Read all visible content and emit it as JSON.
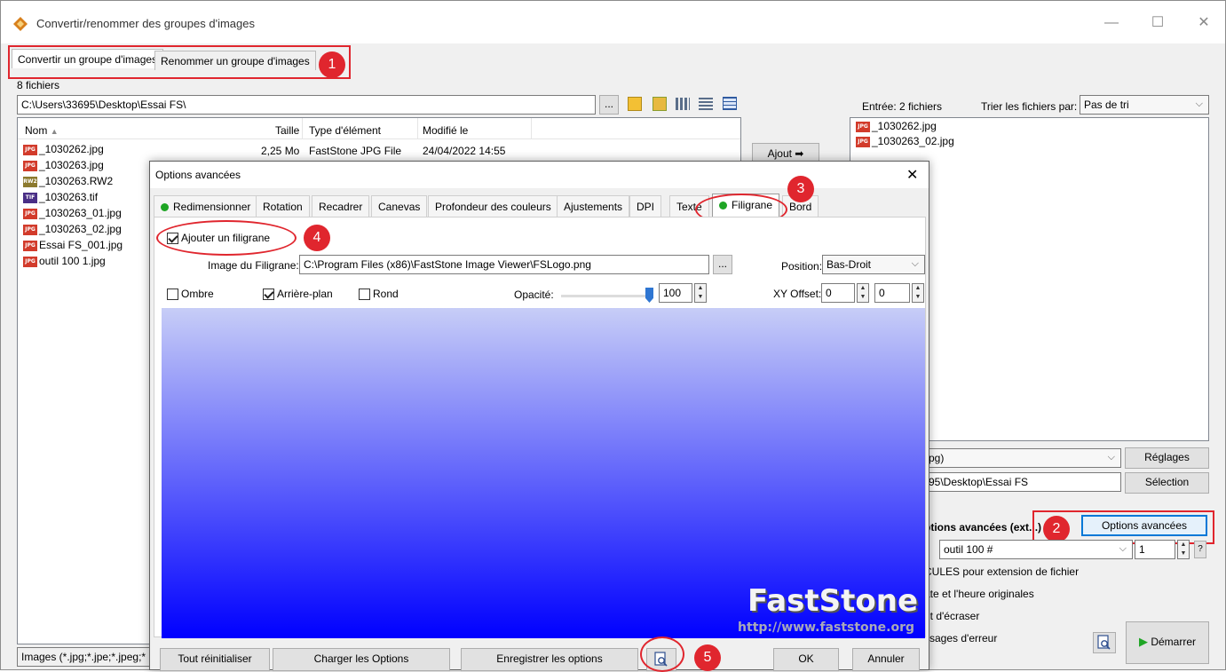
{
  "window": {
    "title": "Convertir/renommer des groupes d'images",
    "minimize": "—",
    "maximize": "☐",
    "close": "✕"
  },
  "main_tabs": [
    "Convertir un groupe d'images",
    "Renommer un groupe d'images"
  ],
  "file_count": "8 fichiers",
  "path": "C:\\Users\\33695\\Desktop\\Essai FS\\",
  "browse": "...",
  "columns": {
    "name": "Nom",
    "size": "Taille",
    "type": "Type d'élément",
    "modified": "Modifié le"
  },
  "files": [
    {
      "icon": "JPG",
      "name": "_1030262.jpg",
      "size": "2,25 Mo",
      "type": "FastStone JPG File",
      "modified": "24/04/2022 14:55"
    },
    {
      "icon": "JPG",
      "name": "_1030263.jpg"
    },
    {
      "icon": "RW2",
      "name": "_1030263.RW2"
    },
    {
      "icon": "TIF",
      "name": "_1030263.tif"
    },
    {
      "icon": "JPG",
      "name": "_1030263_01.jpg"
    },
    {
      "icon": "JPG",
      "name": "_1030263_02.jpg"
    },
    {
      "icon": "JPG",
      "name": "Essai FS_001.jpg"
    },
    {
      "icon": "JPG",
      "name": "outil 100 1.jpg"
    }
  ],
  "filter": "Images (*.jpg;*.jpe;*.jpeg;*",
  "add_button": "Ajout ➡",
  "input_label": "Entrée:  2 fichiers",
  "sort_label": "Trier les fichiers par:",
  "sort_value": "Pas de tri",
  "input_files": [
    "_1030262.jpg",
    "_1030263_02.jpg"
  ],
  "right_panel": {
    "format_value": "pg)",
    "reglages": "Réglages",
    "out_path": "95\\Desktop\\Essai FS",
    "selection": "Sélection",
    "adv_label": "ptions avancées (ext...)",
    "adv_button": "Options avancées",
    "rename_value": "outil 100 #",
    "rename_num": "1",
    "help": "?",
    "opt1": "CULES pour extension de fichier",
    "opt2": "ate et l'heure originales",
    "opt3": "nt d'écraser",
    "opt4": "ssages d'erreur",
    "start": "Démarrer"
  },
  "dialog": {
    "title": "Options avancées",
    "close": "✕",
    "tabs": [
      "Redimensionner",
      "Rotation",
      "Recadrer",
      "Canevas",
      "Profondeur des couleurs",
      "Ajustements",
      "DPI",
      "Texte",
      "Filigrane",
      "Bord"
    ],
    "add_watermark": "Ajouter un filigrane",
    "image_label": "Image du Filigrane:",
    "image_path": "C:\\Program Files (x86)\\FastStone Image Viewer\\FSLogo.png",
    "browse": "...",
    "position_label": "Position:",
    "position_value": "Bas-Droit",
    "shadow": "Ombre",
    "background": "Arrière-plan",
    "round": "Rond",
    "opacity_label": "Opacité:",
    "opacity_value": "100",
    "opacity_level": 1.0,
    "xy_label": "XY Offset:",
    "x_offset": "0",
    "y_offset": "0",
    "logo_main": "FastStone",
    "logo_url": "http://www.faststone.org",
    "btn_reset": "Tout réinitialiser",
    "btn_load": "Charger les Options",
    "btn_save": "Enregistrer les options",
    "btn_ok": "OK",
    "btn_cancel": "Annuler"
  },
  "callouts": [
    "1",
    "2",
    "3",
    "4",
    "5"
  ],
  "colors": {
    "accent_red": "#e0262e",
    "preview_top": "#c7cdf7",
    "preview_bottom": "#0000ff",
    "status_green": "#1ea524"
  }
}
